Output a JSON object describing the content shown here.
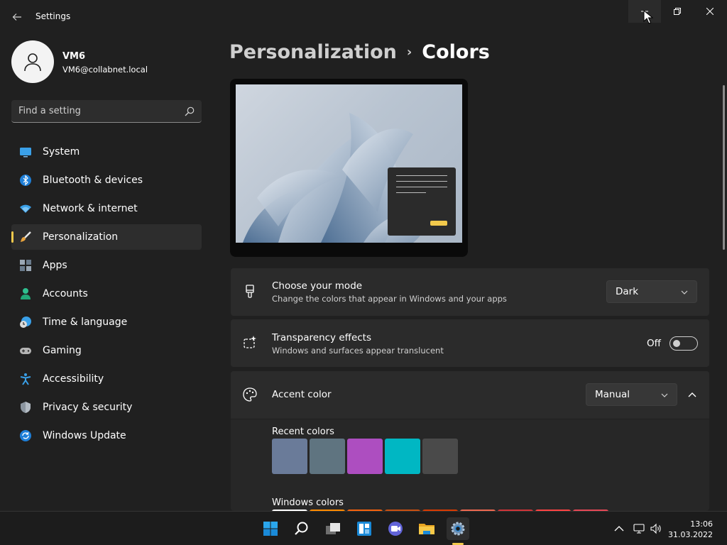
{
  "window": {
    "title": "Settings",
    "controls": [
      "minimize",
      "maximize",
      "close"
    ]
  },
  "account": {
    "name": "VM6",
    "email": "VM6@collabnet.local"
  },
  "search": {
    "placeholder": "Find a setting"
  },
  "sidebar": {
    "items": [
      {
        "label": "System",
        "icon": "monitor-icon",
        "active": false
      },
      {
        "label": "Bluetooth & devices",
        "icon": "bluetooth-icon",
        "active": false
      },
      {
        "label": "Network & internet",
        "icon": "wifi-icon",
        "active": false
      },
      {
        "label": "Personalization",
        "icon": "paintbrush-icon",
        "active": true
      },
      {
        "label": "Apps",
        "icon": "apps-icon",
        "active": false
      },
      {
        "label": "Accounts",
        "icon": "person-icon",
        "active": false
      },
      {
        "label": "Time & language",
        "icon": "clock-globe-icon",
        "active": false
      },
      {
        "label": "Gaming",
        "icon": "gamepad-icon",
        "active": false
      },
      {
        "label": "Accessibility",
        "icon": "accessibility-icon",
        "active": false
      },
      {
        "label": "Privacy & security",
        "icon": "shield-icon",
        "active": false
      },
      {
        "label": "Windows Update",
        "icon": "update-icon",
        "active": false
      }
    ]
  },
  "breadcrumb": {
    "parent": "Personalization",
    "separator": "›",
    "current": "Colors"
  },
  "mode": {
    "title": "Choose your mode",
    "description": "Change the colors that appear in Windows and your apps",
    "value": "Dark"
  },
  "transparency": {
    "title": "Transparency effects",
    "description": "Windows and surfaces appear translucent",
    "state": "Off"
  },
  "accent": {
    "title": "Accent color",
    "value": "Manual",
    "recent_label": "Recent colors",
    "recent_colors": [
      "#6a7b99",
      "#5f7480",
      "#ad4ec0",
      "#00b7c3",
      "#4a4a4a"
    ],
    "windows_label": "Windows colors",
    "windows_colors": [
      "#ffffff",
      "#ff8c00",
      "#f7630c",
      "#ca5010",
      "#da3b01",
      "#ef6950",
      "#d13438",
      "#ff4343",
      "#e74856"
    ]
  },
  "taskbar": {
    "apps": [
      "start-icon",
      "search-icon",
      "task-view-icon",
      "widgets-icon",
      "chat-icon",
      "file-explorer-icon",
      "settings-icon"
    ],
    "active_app": "settings-icon",
    "time": "13:06",
    "date": "31.03.2022"
  },
  "colors": {
    "accent": "#f2c94c",
    "background": "#202020",
    "card": "#2b2b2b"
  }
}
